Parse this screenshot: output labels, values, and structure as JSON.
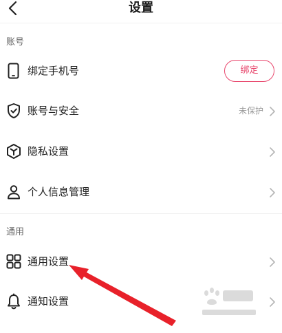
{
  "header": {
    "title": "设置",
    "back_icon": "chevron-left-icon"
  },
  "sections": [
    {
      "label": "账号"
    },
    {
      "label": "通用"
    }
  ],
  "account_items": [
    {
      "label": "绑定手机号",
      "icon": "phone-icon",
      "action_label": "绑定"
    },
    {
      "label": "账号与安全",
      "icon": "shield-check-icon",
      "status": "未保护"
    },
    {
      "label": "隐私设置",
      "icon": "privacy-box-icon"
    },
    {
      "label": "个人信息管理",
      "icon": "person-icon"
    }
  ],
  "general_items": [
    {
      "label": "通用设置",
      "icon": "grid-icon"
    },
    {
      "label": "通知设置",
      "icon": "bell-icon"
    }
  ],
  "annotation": {
    "color": "#e8212a",
    "icon": "red-arrow"
  },
  "watermark": {
    "icon": "baidu-jingyan-watermark"
  },
  "colors": {
    "accent": "#e8466c",
    "muted": "#999999"
  }
}
